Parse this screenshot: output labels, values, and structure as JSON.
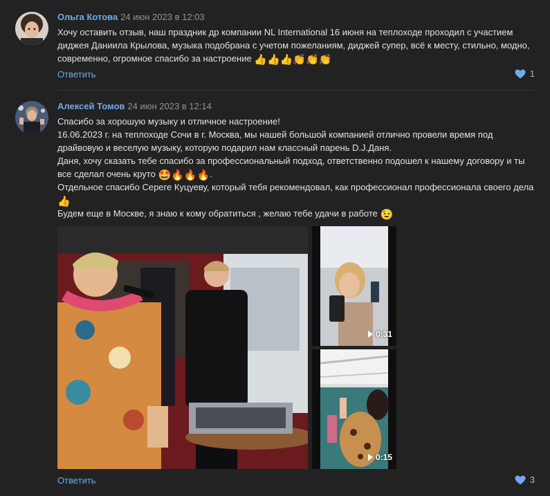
{
  "comments": [
    {
      "author": "Ольга Котова",
      "date": "24 июн 2023 в 12:03",
      "lines": [
        "Хочу оставить отзыв, наш праздник др компании NL International 16 июня на теплоходе проходил с участием",
        "диджея Даниила Крылова, музыка подобрана с учетом пожеланиям, диджей супер, всё к месту, стильно, модно,",
        "современно, огромное спасибо за настроение"
      ],
      "emojis": "👍👍👍👏👏👏",
      "reply_label": "Ответить",
      "likes": "1"
    },
    {
      "author": "Алексей Томов",
      "date": "24 июн 2023 в 12:14",
      "lines": [
        "Спасибо за хорошую музыку и отличное настроение!",
        "16.06.2023 г. на теплоходе Сочи в г. Москва, мы нашей большой компанией отлично провели время под",
        "драйвовую и веселую музыку, которую подарил нам классный парень D.J.Даня.",
        "Даня, хочу сказать тебе спасибо за профессиональный подход, ответственно подошел к нашему договору и ты",
        "все сделал очень круто",
        "Отдельное спасибо Сереге Куцуеву, который тебя рекомендовал, как профессионал профессионала своего дела",
        "Будем еще в Москве, я знаю к кому обратиться , желаю тебе удачи в работе"
      ],
      "emoji_line5": "🤩🔥🔥🔥",
      "emoji_line5_suffix": ".",
      "emoji_line6": "👍",
      "emoji_line7": "😉",
      "videos": [
        {
          "duration": "0:31"
        },
        {
          "duration": "0:15"
        }
      ],
      "reply_label": "Ответить",
      "likes": "3"
    }
  ],
  "colors": {
    "background": "#222222",
    "link": "#71aaeb",
    "text": "#e1e3e6",
    "muted": "#939393",
    "like_heart": "#71aaeb"
  }
}
